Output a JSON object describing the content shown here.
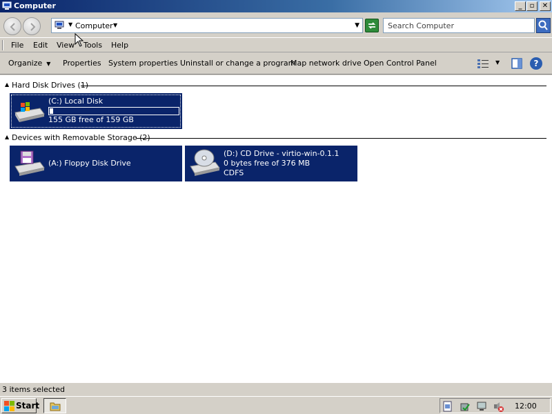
{
  "window": {
    "title": "Computer"
  },
  "address": {
    "crumb": "Computer",
    "search_placeholder": "Search Computer"
  },
  "menu": [
    "File",
    "Edit",
    "View",
    "Tools",
    "Help"
  ],
  "commands": {
    "organize": "Organize",
    "properties": "Properties",
    "system_properties": "System properties",
    "uninstall": "Uninstall or change a program",
    "map_drive": "Map network drive",
    "control_panel": "Open Control Panel"
  },
  "groups": {
    "hdd": {
      "label": "Hard Disk Drives (1)"
    },
    "removable": {
      "label": "Devices with Removable Storage (2)"
    }
  },
  "drives": {
    "c": {
      "name": "(C:) Local Disk",
      "free": "155 GB free of 159 GB",
      "used_fraction": 0.025,
      "icon": "hard-disk-icon"
    },
    "a": {
      "name": "(A:) Floppy Disk Drive",
      "icon": "floppy-drive-icon"
    },
    "d": {
      "name": "(D:) CD Drive - virtio-win-0.1.1",
      "free": "0 bytes free of 376 MB",
      "fs": "CDFS",
      "icon": "cd-drive-icon"
    }
  },
  "status": {
    "text": "3 items selected"
  },
  "taskbar": {
    "start": "Start",
    "clock": "12:00"
  },
  "colors": {
    "selection": "#0a246a",
    "titlebar": "#0a246a",
    "chrome": "#d4d0c8"
  }
}
